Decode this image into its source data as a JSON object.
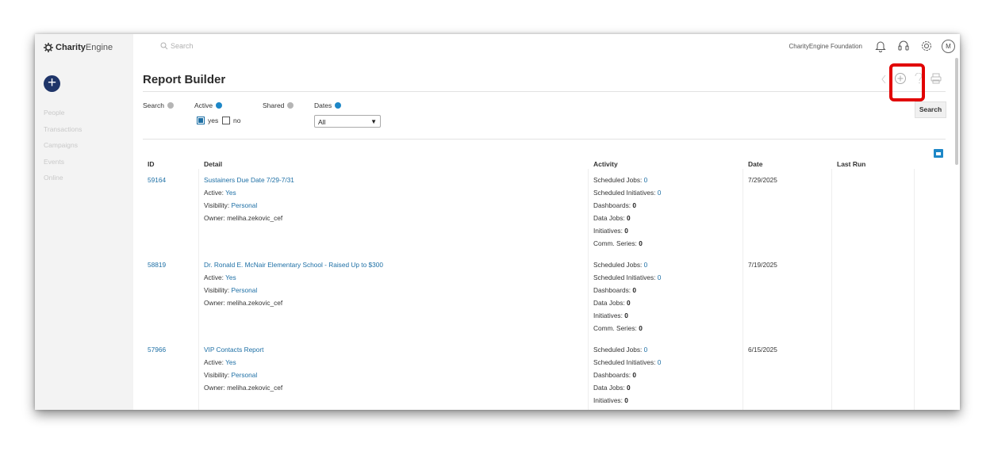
{
  "app": {
    "brand_bold": "Charity",
    "brand_light": "Engine",
    "org_name": "CharityEngine Foundation",
    "user_initial": "M"
  },
  "search": {
    "placeholder": "Search"
  },
  "sidebar": {
    "items": [
      {
        "label": "People"
      },
      {
        "label": "Transactions"
      },
      {
        "label": "Campaigns"
      },
      {
        "label": "Events"
      },
      {
        "label": "Online"
      }
    ]
  },
  "page": {
    "title": "Report Builder"
  },
  "filters": {
    "search_label": "Search",
    "active_label": "Active",
    "shared_label": "Shared",
    "dates_label": "Dates",
    "yes_label": "yes",
    "no_label": "no",
    "dates_value": "All",
    "search_button": "Search"
  },
  "table": {
    "headers": {
      "id": "ID",
      "detail": "Detail",
      "activity": "Activity",
      "date": "Date",
      "last_run": "Last Run"
    },
    "labels": {
      "active": "Active:",
      "visibility": "Visibility:",
      "owner": "Owner:",
      "scheduled_jobs": "Scheduled Jobs:",
      "scheduled_initiatives": "Scheduled Initiatives:",
      "dashboards": "Dashboards:",
      "data_jobs": "Data Jobs:",
      "initiatives": "Initiatives:",
      "comm_series": "Comm. Series:"
    },
    "rows": [
      {
        "id": "59164",
        "name": "Sustainers Due Date 7/29-7/31",
        "active": "Yes",
        "visibility": "Personal",
        "owner": "meliha.zekovic_cef",
        "scheduled_jobs": "0",
        "scheduled_initiatives": "0",
        "dashboards": "0",
        "data_jobs": "0",
        "initiatives": "0",
        "comm_series": "0",
        "date": "7/29/2025",
        "last_run": ""
      },
      {
        "id": "58819",
        "name": "Dr. Ronald E. McNair Elementary School - Raised Up to $300",
        "active": "Yes",
        "visibility": "Personal",
        "owner": "meliha.zekovic_cef",
        "scheduled_jobs": "0",
        "scheduled_initiatives": "0",
        "dashboards": "0",
        "data_jobs": "0",
        "initiatives": "0",
        "comm_series": "0",
        "date": "7/19/2025",
        "last_run": ""
      },
      {
        "id": "57966",
        "name": "VIP Contacts Report",
        "active": "Yes",
        "visibility": "Personal",
        "owner": "meliha.zekovic_cef",
        "scheduled_jobs": "0",
        "scheduled_initiatives": "0",
        "dashboards": "0",
        "data_jobs": "0",
        "initiatives": "0",
        "comm_series": "",
        "date": "6/15/2025",
        "last_run": ""
      }
    ]
  },
  "colors": {
    "accent": "#1d87c7",
    "link": "#1d6fa5",
    "highlight": "#e10000",
    "nav_circle": "#1f3569"
  }
}
